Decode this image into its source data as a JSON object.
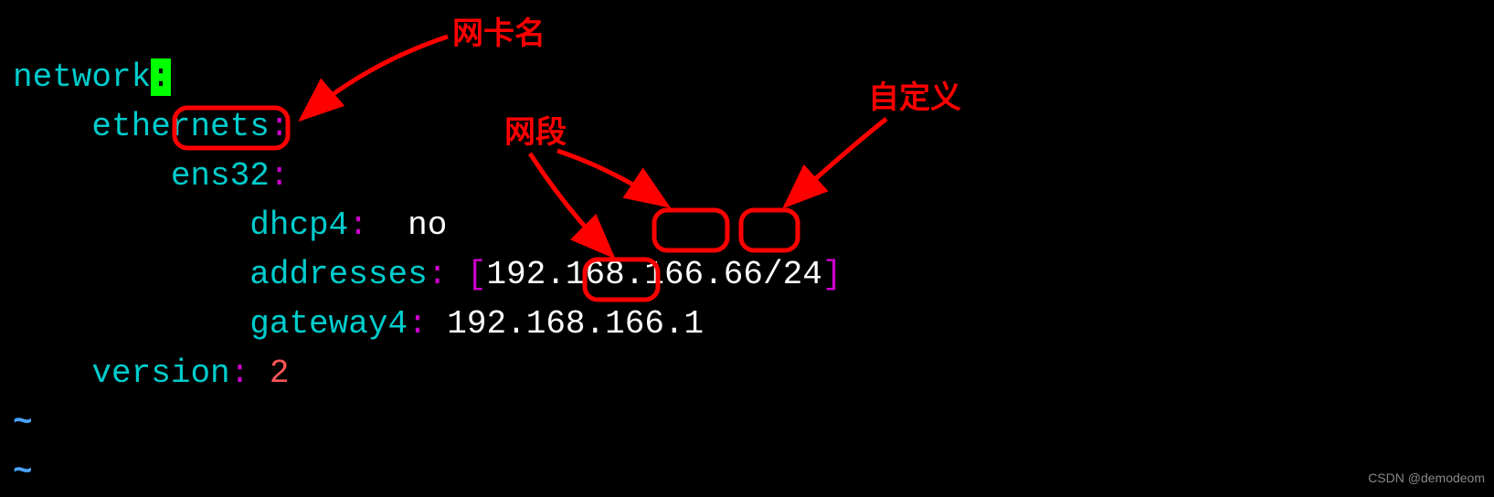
{
  "code": {
    "k_network": "network",
    "cursor_char": ":",
    "k_ethernets": "ethernets",
    "k_iface": "ens32",
    "k_dhcp4": "dhcp4",
    "v_dhcp4": "no",
    "k_addresses": "addresses",
    "v_addr_pre": "192.168.",
    "v_addr_seg": "166",
    "v_addr_dot": ".",
    "v_addr_host": "66",
    "v_addr_cidr": "/24",
    "k_gateway4": "gateway4",
    "v_gw_pre": "192.168.",
    "v_gw_seg": "166",
    "v_gw_suffix": ".1",
    "k_version": "version",
    "v_version": "2",
    "tilde": "~"
  },
  "annotations": {
    "nic_name": "网卡名",
    "segment": "网段",
    "custom": "自定义"
  },
  "watermark": "CSDN @demodeom"
}
